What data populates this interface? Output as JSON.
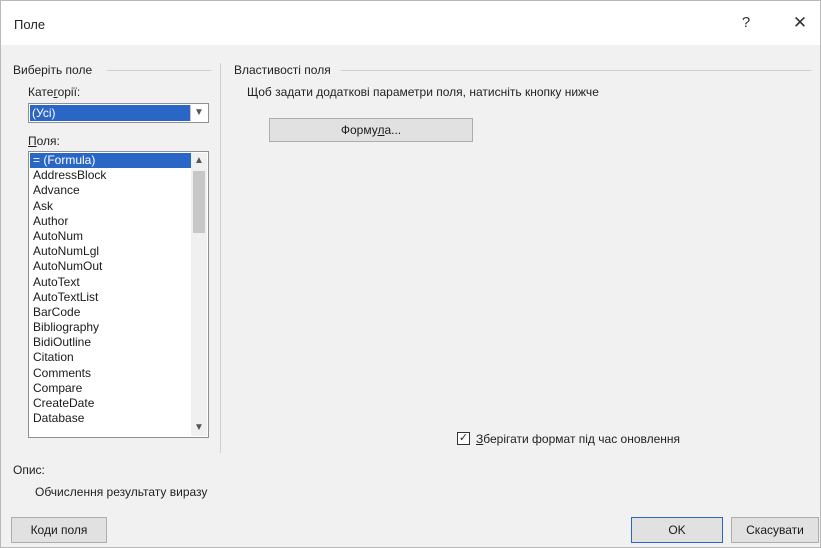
{
  "window": {
    "title": "Поле",
    "help_glyph": "?",
    "close_glyph": "✕"
  },
  "left_panel": {
    "group_title": "Виберіть поле",
    "category_label_pre": "Кате",
    "category_label_u": "г",
    "category_label_post": "орії:",
    "category_value": "(Усі)",
    "fields_label_u": "П",
    "fields_label_post": "оля:",
    "fields": [
      "= (Formula)",
      "AddressBlock",
      "Advance",
      "Ask",
      "Author",
      "AutoNum",
      "AutoNumLgl",
      "AutoNumOut",
      "AutoText",
      "AutoTextList",
      "BarCode",
      "Bibliography",
      "BidiOutline",
      "Citation",
      "Comments",
      "Compare",
      "CreateDate",
      "Database"
    ],
    "selected_field_index": 0
  },
  "right_panel": {
    "group_title": "Властивості поля",
    "hint": "Щоб задати додаткові параметри поля, натисніть кнопку нижче",
    "formula_button_pre": "Форму",
    "formula_button_u": "л",
    "formula_button_post": "а...",
    "preserve_format_u": "З",
    "preserve_format_post": "берігати формат під час оновлення",
    "preserve_format_checked": true,
    "check_glyph": "✓"
  },
  "description": {
    "label": "Опис:",
    "text": "Обчислення результату виразу"
  },
  "footer": {
    "field_codes_pre": "Ко",
    "field_codes_u": "д",
    "field_codes_post": "и поля",
    "ok_label": "OK",
    "cancel_label": "Скасувати"
  }
}
